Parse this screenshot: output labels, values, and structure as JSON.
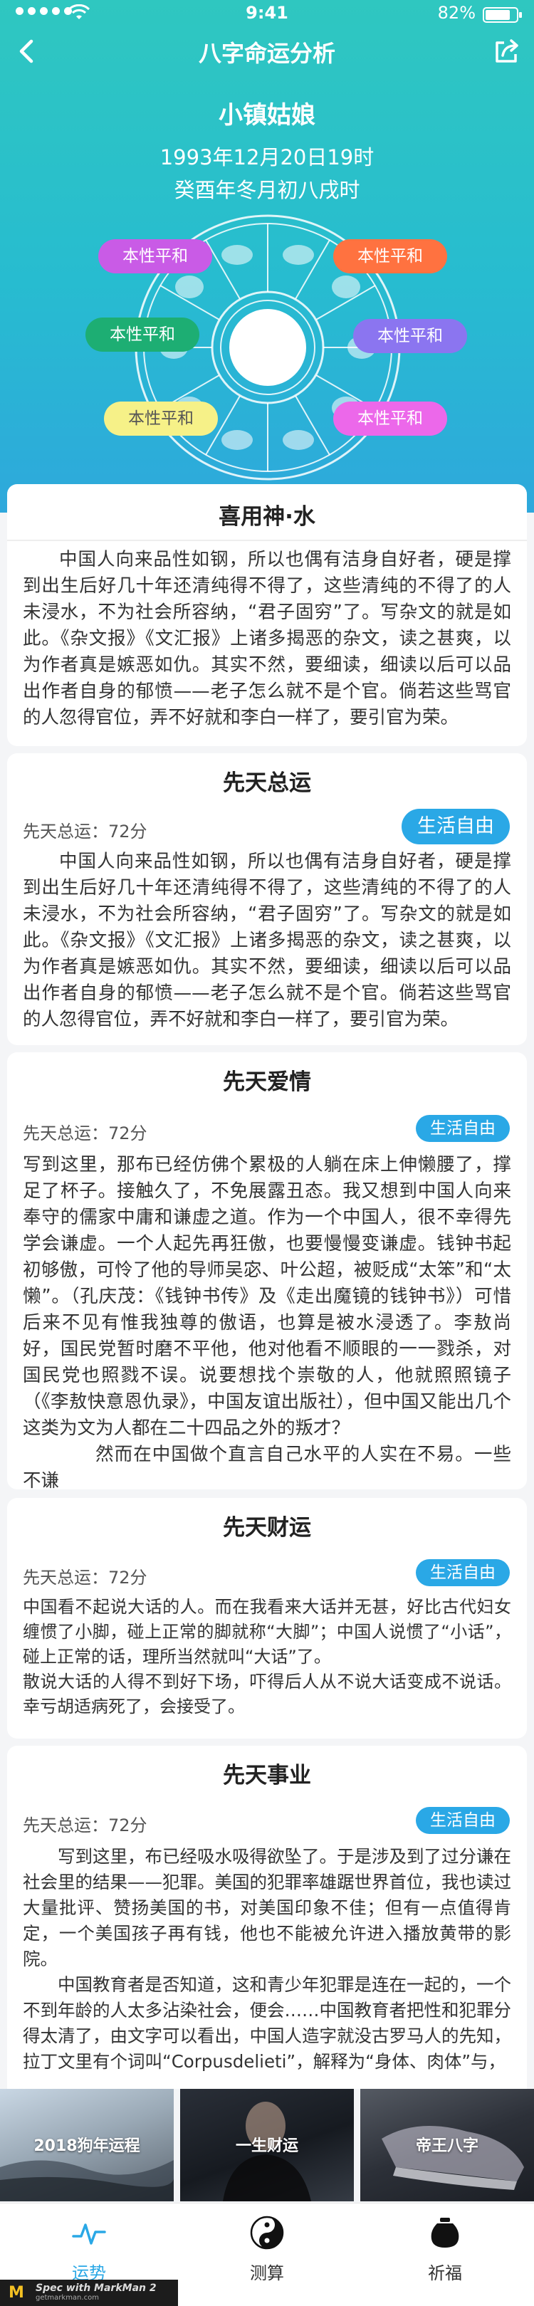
{
  "status": {
    "time": "9:41",
    "battery": "82%"
  },
  "nav": {
    "title": "八字命运分析",
    "back_icon": "back-chevron-icon",
    "share_icon": "share-icon"
  },
  "profile": {
    "name": "小镇姑娘",
    "solar_date": "1993年12月20日19时",
    "lunar_date": "癸酉年冬月初八戌时"
  },
  "tags": [
    "本性平和",
    "本性平和",
    "本性平和",
    "本性平和",
    "本性平和",
    "本性平和"
  ],
  "sections": {
    "xiyong": {
      "title": "喜用神·水",
      "paragraphs": [
        "中国人向来品性如钢，所以也偶有洁身自好者，硬是撑到出生后好几十年还清纯得不得了，这些清纯的不得了的人未浸水，不为社会所容纳，“君子固穷”了。写杂文的就是如此。《杂文报》《文汇报》上诸多揭恶的杂文，读之甚爽，以为作者真是嫉恶如仇。其实不然，要细读，细读以后可以品出作者自身的郁愤——老子怎么就不是个官。倘若这些骂官的人忽得官位，弄不好就和李白一样了，要引官为荣。"
      ]
    },
    "zongyun": {
      "title": "先天总运",
      "score": "先天总运：72分",
      "badge": "生活自由",
      "paragraphs": [
        "中国人向来品性如钢，所以也偶有洁身自好者，硬是撑到出生后好几十年还清纯得不得了，这些清纯的不得了的人未浸水，不为社会所容纳，“君子固穷”了。写杂文的就是如此。《杂文报》《文汇报》上诸多揭恶的杂文，读之甚爽，以为作者真是嫉恶如仇。其实不然，要细读，细读以后可以品出作者自身的郁愤——老子怎么就不是个官。倘若这些骂官的人忽得官位，弄不好就和李白一样了，要引官为荣。"
      ]
    },
    "aiqing": {
      "title": "先天爱情",
      "score": "先天总运：72分",
      "badge": "生活自由",
      "paragraphs": [
        "写到这里，那布已经仿佛个累极的人躺在床上伸懒腰了，撑足了杯子。接触久了，不免展露丑态。我又想到中国人向来奉守的儒家中庸和谦虚之道。作为一个中国人，很不幸得先学会谦虚。一个人起先再狂傲，也要慢慢变谦虚。钱钟书起初够傲，可怜了他的导师吴宓、叶公超，被贬成“太笨”和“太懒”。（孔庆茂：《钱钟书传》及《走出魔镜的钱钟书》）可惜后来不见有惟我独尊的傲语，也算是被水浸透了。李敖尚好，国民党暂时磨不平他，他对他看不顺眼的一一戮杀，对国民党也照戮不误。说要想找个崇敬的人，他就照照镜子（《李敖快意恩仇录》，中国友谊出版社），但中国又能出几个这类为文为人都在二十四品之外的叛才？",
        "然而在中国做个直言自己水平的人实在不易。一些不谦"
      ]
    },
    "caiyun": {
      "title": "先天财运",
      "score": "先天总运：72分",
      "badge": "生活自由",
      "paragraphs": [
        "中国看不起说大话的人。而在我看来大话并无甚，好比古代妇女缠惯了小脚，碰上正常的脚就称“大脚”；中国人说惯了“小话”，碰上正常的话，理所当然就叫“大话”了。",
        "散说大话的人得不到好下场，吓得后人从不说大话变成不说话。幸亏胡适病死了，会接受了。"
      ]
    },
    "shiye": {
      "title": "先天事业",
      "score": "先天总运：72分",
      "badge": "生活自由",
      "paragraphs": [
        "写到这里，布已经吸水吸得欲坠了。于是涉及到了过分谦在社会里的结果——犯罪。美国的犯罪率雄踞世界首位，我也读过大量批评、赞扬美国的书，对美国印象不佳；但有一点值得肯定，一个美国孩子再有钱，他也不能被允许进入播放黄带的影院。",
        "中国教育者是否知道，这和青少年犯罪是连在一起的，一个不到年龄的人太多沾染社会，便会……中国教育者把性和犯罪分得太清了，由文字可以看出，中国人造字就没古罗马人的先知，拉丁文里有个词叫“Corpusdelieti”，解释为“身体、肉体”与，"
      ]
    }
  },
  "banners": [
    "2018狗年运程",
    "一生财运",
    "帝王八字"
  ],
  "tabs": [
    {
      "label": "运势",
      "icon": "fortune-pulse-icon",
      "active": true
    },
    {
      "label": "测算",
      "icon": "yin-yang-icon",
      "active": false
    },
    {
      "label": "祈福",
      "icon": "pot-icon",
      "active": false
    }
  ],
  "watermark": {
    "brand": "Spec with MarkMan 2",
    "site": "getmarkman.com"
  },
  "colors": {
    "header_top": "#2fc7c0",
    "header_bottom": "#2ea8dc",
    "accent_blue": "#2aa8e6",
    "tag_purple": "#c95be6",
    "tag_orange": "#ff7240",
    "tag_green": "#1dae73",
    "tag_violet": "#8b75f0",
    "tag_yellow": "#f6f188",
    "tag_pink": "#ec68ea"
  }
}
